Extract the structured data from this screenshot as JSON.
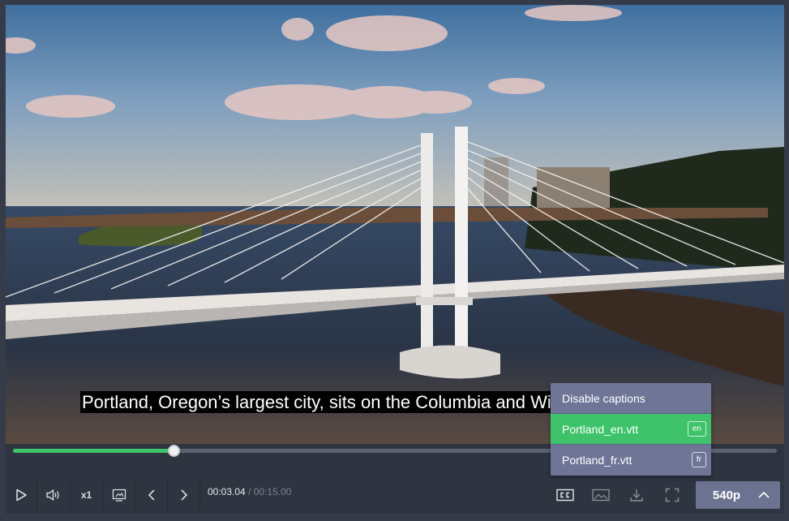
{
  "video": {
    "subtitle": "Portland, Oregon’s largest city, sits on the Columbia and Willamette rivers."
  },
  "progress": {
    "played_fraction": 0.21
  },
  "controls": {
    "speed_label": "x1",
    "current_time": "00:03.04",
    "duration": "/ 00:15.00",
    "quality_label": "540p"
  },
  "captions_menu": {
    "disable_label": "Disable captions",
    "tracks": [
      {
        "label": "Portland_en.vtt",
        "lang": "en",
        "selected": true
      },
      {
        "label": "Portland_fr.vtt",
        "lang": "fr",
        "selected": false
      }
    ]
  },
  "colors": {
    "accent": "#3fc36a",
    "menu_bg": "#6e7596",
    "control_bar": "#2e3440"
  }
}
